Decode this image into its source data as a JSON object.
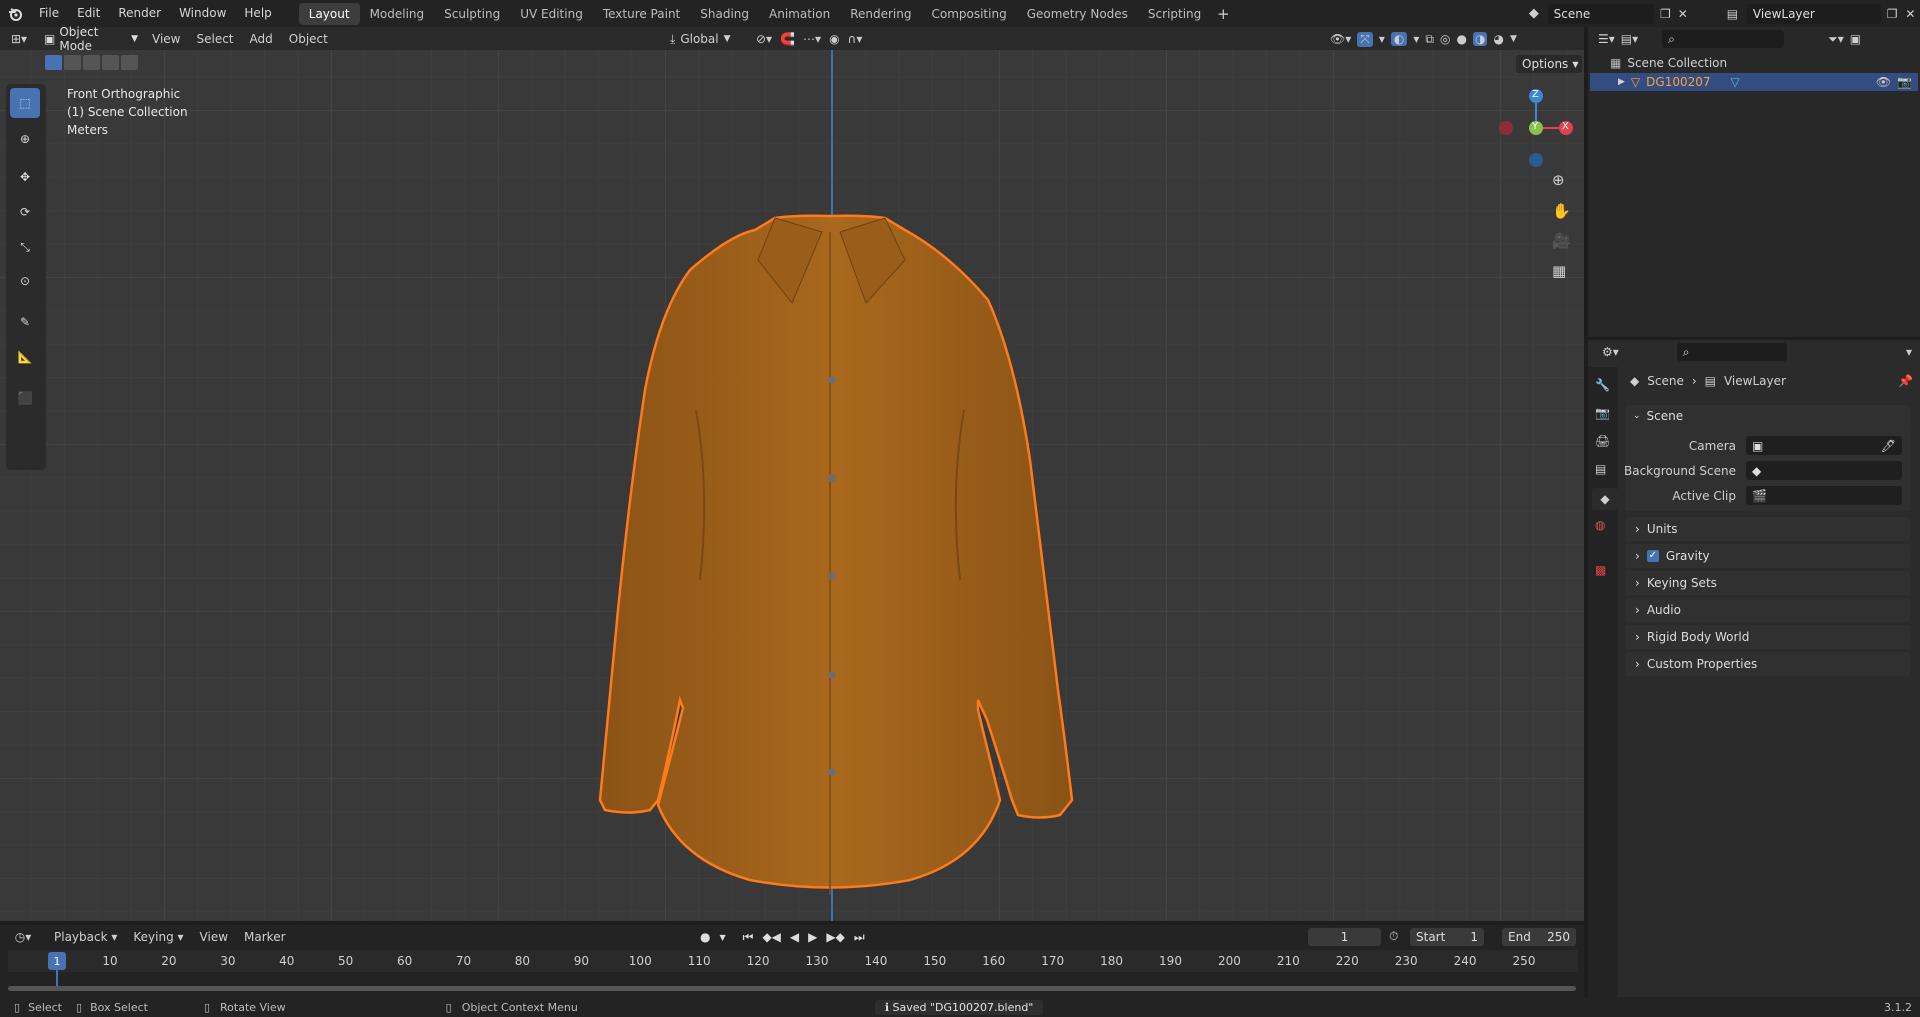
{
  "menu": [
    "File",
    "Edit",
    "Render",
    "Window",
    "Help"
  ],
  "workspaces": [
    "Layout",
    "Modeling",
    "Sculpting",
    "UV Editing",
    "Texture Paint",
    "Shading",
    "Animation",
    "Rendering",
    "Compositing",
    "Geometry Nodes",
    "Scripting"
  ],
  "active_workspace": "Layout",
  "scene_name": "Scene",
  "view_layer_name": "ViewLayer",
  "viewport_header": {
    "mode": "Object Mode",
    "menus": [
      "View",
      "Select",
      "Add",
      "Object"
    ],
    "orientation": "Global",
    "options_label": "Options"
  },
  "viewport_overlay": {
    "view_name": "Front Orthographic",
    "collection": "(1) Scene Collection",
    "units": "Meters"
  },
  "gizmo": {
    "z": "Z",
    "y": "Y",
    "x": "X"
  },
  "outliner": {
    "root": "Scene Collection",
    "object_name": "DG100207"
  },
  "properties": {
    "breadcrumb": [
      "Scene",
      "ViewLayer"
    ],
    "scene_panel_title": "Scene",
    "fields": [
      {
        "label": "Camera"
      },
      {
        "label": "Background Scene"
      },
      {
        "label": "Active Clip"
      }
    ],
    "subpanels": [
      "Units",
      "Gravity",
      "Keying Sets",
      "Audio",
      "Rigid Body World",
      "Custom Properties"
    ],
    "gravity_checked": true
  },
  "timeline": {
    "menus": [
      "Playback",
      "Keying",
      "View",
      "Marker"
    ],
    "current_frame": "1",
    "start_label": "Start",
    "start": "1",
    "end_label": "End",
    "end": "250",
    "ticks": [
      "1",
      "10",
      "20",
      "30",
      "40",
      "50",
      "60",
      "70",
      "80",
      "90",
      "100",
      "110",
      "120",
      "130",
      "140",
      "150",
      "160",
      "170",
      "180",
      "190",
      "200",
      "210",
      "220",
      "230",
      "240",
      "250"
    ]
  },
  "statusbar": {
    "select": "Select",
    "box_select": "Box Select",
    "rotate_view": "Rotate View",
    "context_menu": "Object Context Menu",
    "message": "Saved \"DG100207.blend\"",
    "version": "3.1.2"
  },
  "colors": {
    "accent": "#4772b3",
    "selection_outline": "#ff7a1a",
    "shirt": "#a8661c",
    "axis_x": "#e0424f",
    "axis_y": "#8bc34a",
    "axis_z": "#3d86d8"
  }
}
